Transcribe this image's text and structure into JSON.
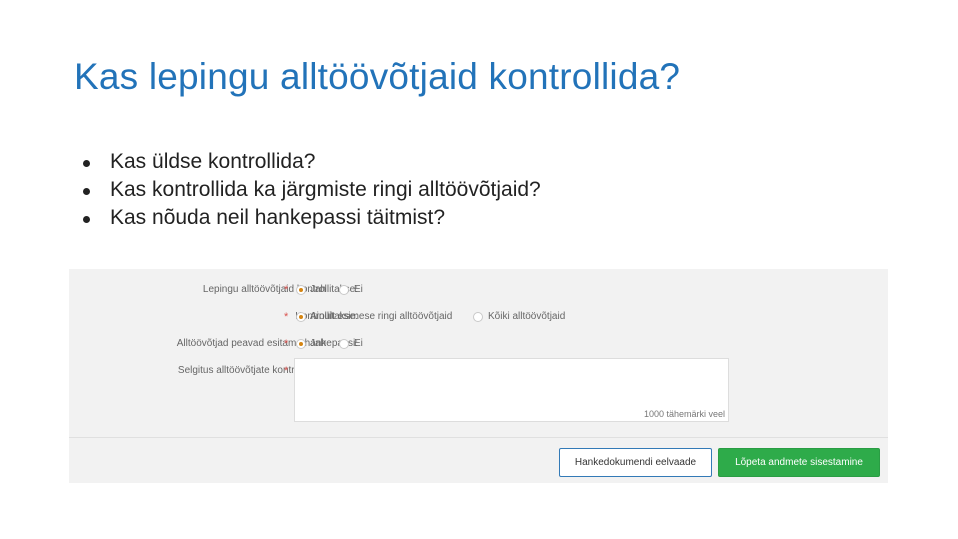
{
  "title": "Kas lepingu alltöövõtjaid kontrollida?",
  "bullets": [
    "Kas üldse kontrollida?",
    "Kas kontrollida ka järgmiste ringi alltöövõtjaid?",
    "Kas nõuda neil hankepassi täitmist?"
  ],
  "form": {
    "required_mark": "*",
    "rows": [
      {
        "label": "Lepingu alltöövõtjaid kontrollitakse:",
        "options": [
          {
            "label": "Jah",
            "checked": true
          },
          {
            "label": "Ei",
            "checked": false
          }
        ]
      },
      {
        "label": "Kontrollitakse:",
        "options": [
          {
            "label": "Ainult esimese ringi alltöövõtjaid",
            "checked": true
          },
          {
            "label": "Kõiki alltöövõtjaid",
            "checked": false
          }
        ]
      },
      {
        "label": "Alltöövõtjad peavad esitama hankepassi:",
        "options": [
          {
            "label": "Jah",
            "checked": true
          },
          {
            "label": "Ei",
            "checked": false
          }
        ]
      }
    ],
    "explanation": {
      "label": "Selgitus alltöövõtjate kontrollimise kohta:",
      "value": "",
      "counter": "1000 tähemärki veel"
    },
    "buttons": {
      "preview": "Hankedokumendi eelvaade",
      "finish": "Lõpeta andmete sisestamine"
    }
  },
  "colors": {
    "title": "#2273b9",
    "radio_checked": "#d58512",
    "finish_button": "#2eab4a",
    "preview_border": "#337ab7"
  }
}
